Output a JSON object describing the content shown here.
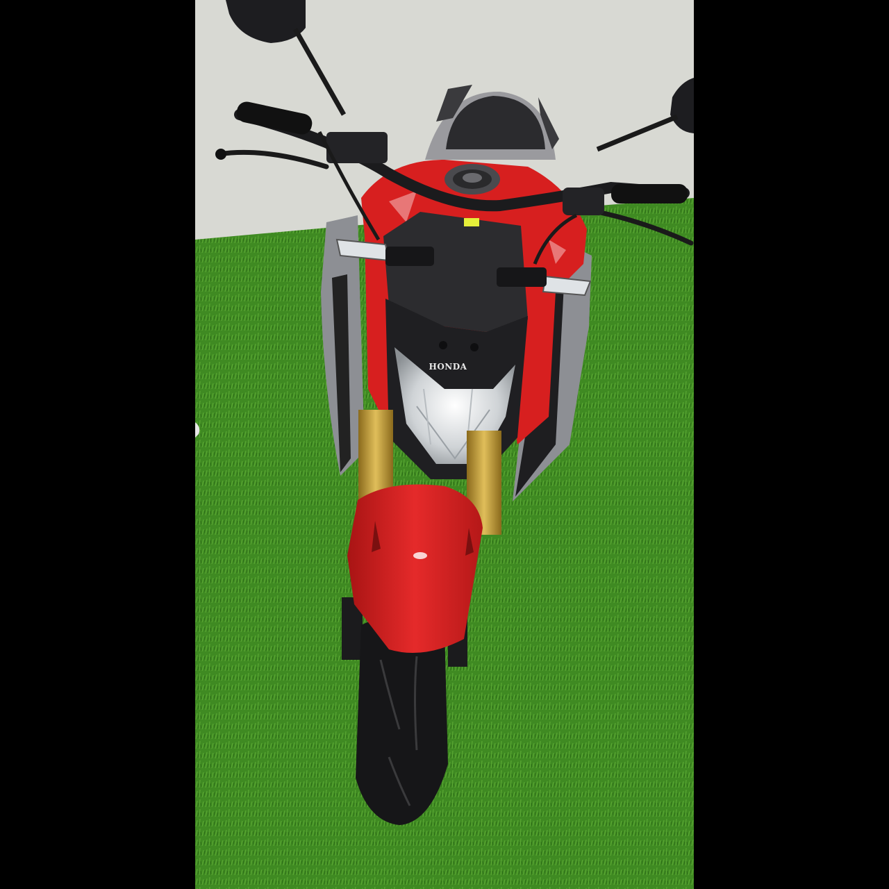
{
  "photo": {
    "subject": "motorcycle-front-view",
    "colors": {
      "bodywork": "#d71f1f",
      "fork": "#c9a13a",
      "turf": "#3f8a22",
      "wall": "#d8d9d3",
      "frame": "#000000"
    }
  },
  "headlight": {
    "brand_text": "HONDA"
  }
}
